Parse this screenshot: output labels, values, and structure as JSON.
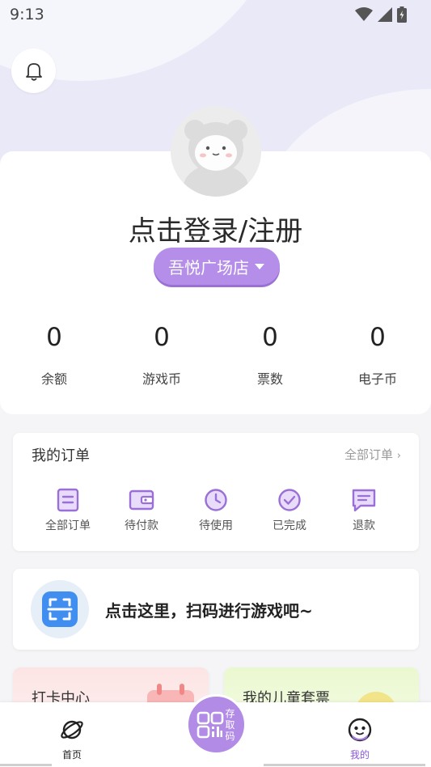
{
  "status_bar": {
    "time": "9:13"
  },
  "profile": {
    "login_text": "点击登录/注册",
    "store_name": "吾悦广场店",
    "stats": [
      {
        "value": "0",
        "label": "余额"
      },
      {
        "value": "0",
        "label": "游戏币"
      },
      {
        "value": "0",
        "label": "票数"
      },
      {
        "value": "0",
        "label": "电子币"
      }
    ]
  },
  "orders": {
    "title": "我的订单",
    "all_link": "全部订单",
    "items": [
      {
        "label": "全部订单",
        "icon": "order-list-icon"
      },
      {
        "label": "待付款",
        "icon": "wallet-icon"
      },
      {
        "label": "待使用",
        "icon": "clock-icon"
      },
      {
        "label": "已完成",
        "icon": "check-circle-icon"
      },
      {
        "label": "退款",
        "icon": "refund-icon"
      }
    ]
  },
  "scan": {
    "text": "点击这里，扫码进行游戏吧~",
    "icon": "scan-icon"
  },
  "mini_cards": [
    {
      "title": "打卡中心"
    },
    {
      "title": "我的儿童套票"
    }
  ],
  "tabbar": {
    "home_label": "首页",
    "center_label": "存取码",
    "mine_label": "我的"
  },
  "colors": {
    "accent": "#b48ee8",
    "accent_dark": "#8a58d6",
    "scan_blue": "#3f8ef0"
  }
}
